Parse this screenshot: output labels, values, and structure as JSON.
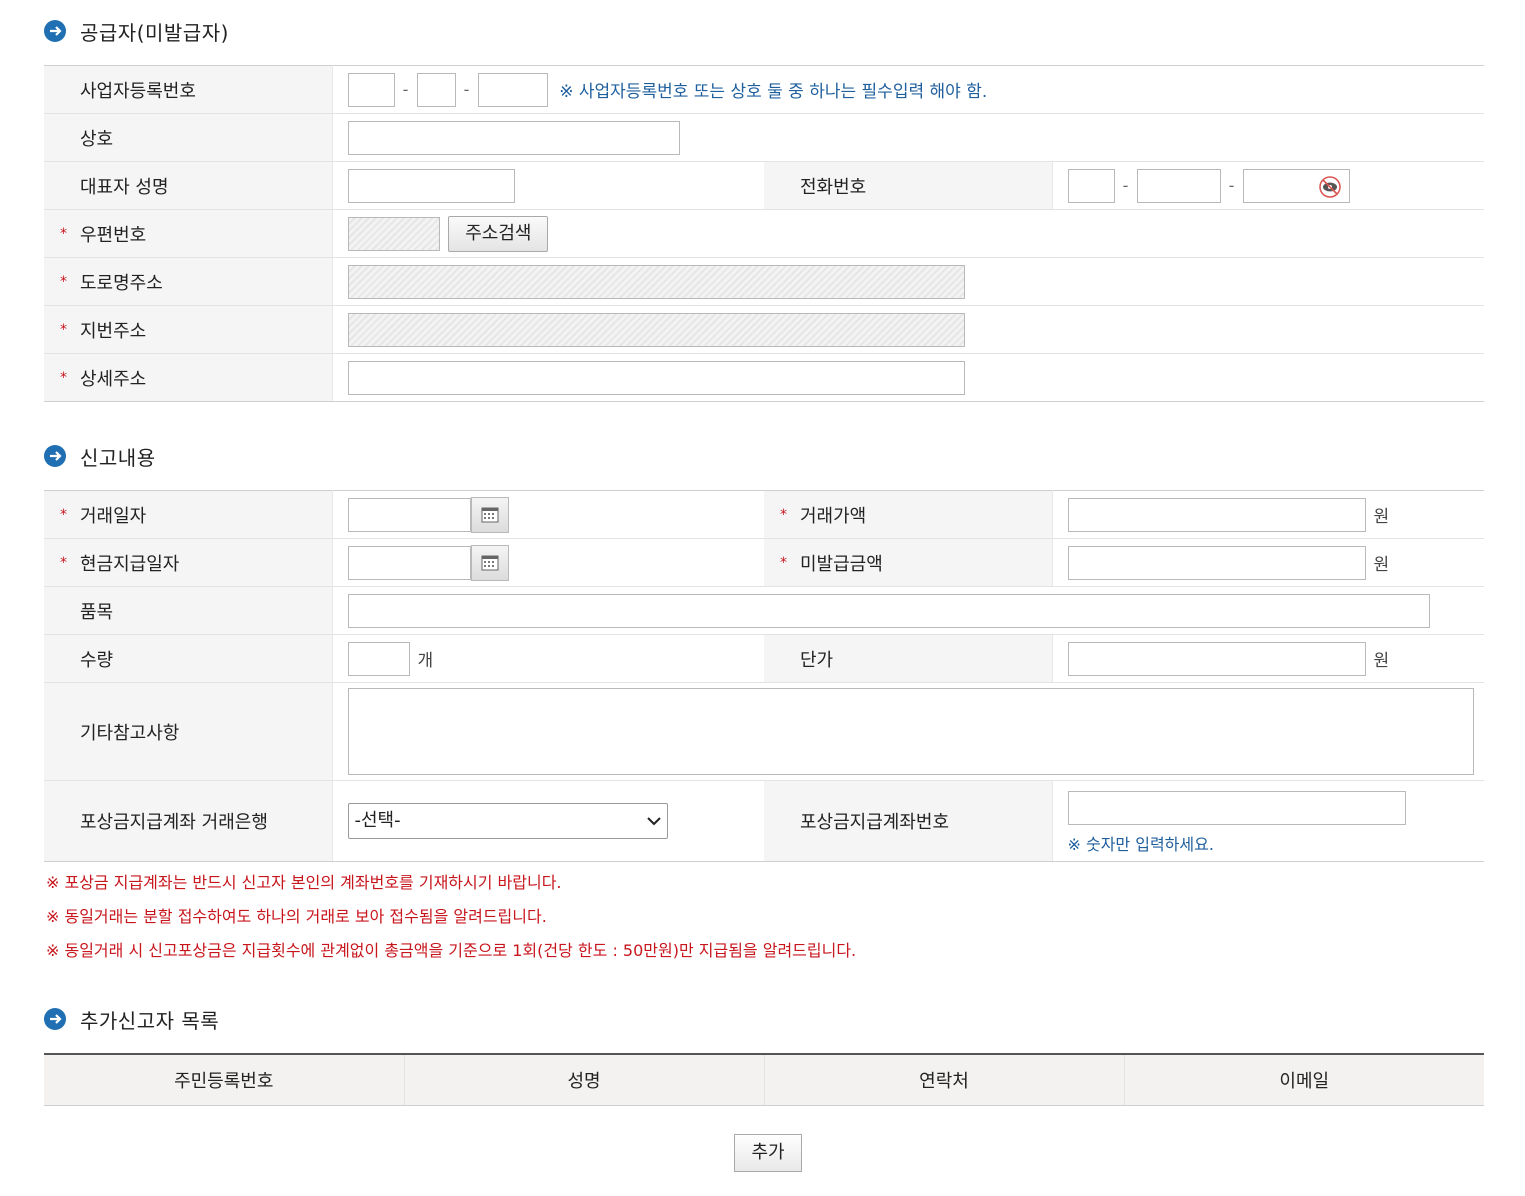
{
  "sections": {
    "supplier": "공급자(미발급자)",
    "report": "신고내용",
    "additional": "추가신고자 목록"
  },
  "supplier": {
    "biz_no_label": "사업자등록번호",
    "biz_note": "※ 사업자등록번호 또는 상호 둘 중 하나는 필수입력 해야 함.",
    "company_label": "상호",
    "rep_label": "대표자 성명",
    "phone_label": "전화번호",
    "zip_label": "우편번호",
    "addr_search": "주소검색",
    "road_label": "도로명주소",
    "jibun_label": "지번주소",
    "detail_label": "상세주소",
    "dash": "-"
  },
  "report": {
    "trade_date": "거래일자",
    "trade_amount": "거래가액",
    "cash_date": "현금지급일자",
    "unissued_amount": "미발급금액",
    "item": "품목",
    "qty": "수량",
    "qty_unit": "개",
    "price": "단가",
    "won": "원",
    "etc": "기타참고사항",
    "bank_label": "포상금지급계좌 거래은행",
    "bank_selected": "-선택-",
    "account_label": "포상금지급계좌번호",
    "account_note": "※ 숫자만 입력하세요."
  },
  "notes": [
    "※ 포상금 지급계좌는 반드시 신고자 본인의 계좌번호를 기재하시기 바랍니다.",
    "※ 동일거래는 분할 접수하여도 하나의 거래로 보아 접수됨을 알려드립니다.",
    "※ 동일거래 시 신고포상금은 지급횟수에 관계없이 총금액을 기준으로 1회(건당 한도 : 50만원)만 지급됨을 알려드립니다."
  ],
  "list": {
    "headers": [
      "주민등록번호",
      "성명",
      "연락처",
      "이메일"
    ],
    "add_button": "추가"
  },
  "required_mark": "*",
  "colors": {
    "accent": "#1f6fb2",
    "required": "#c8161d",
    "note_blue": "#1f5f9e"
  }
}
